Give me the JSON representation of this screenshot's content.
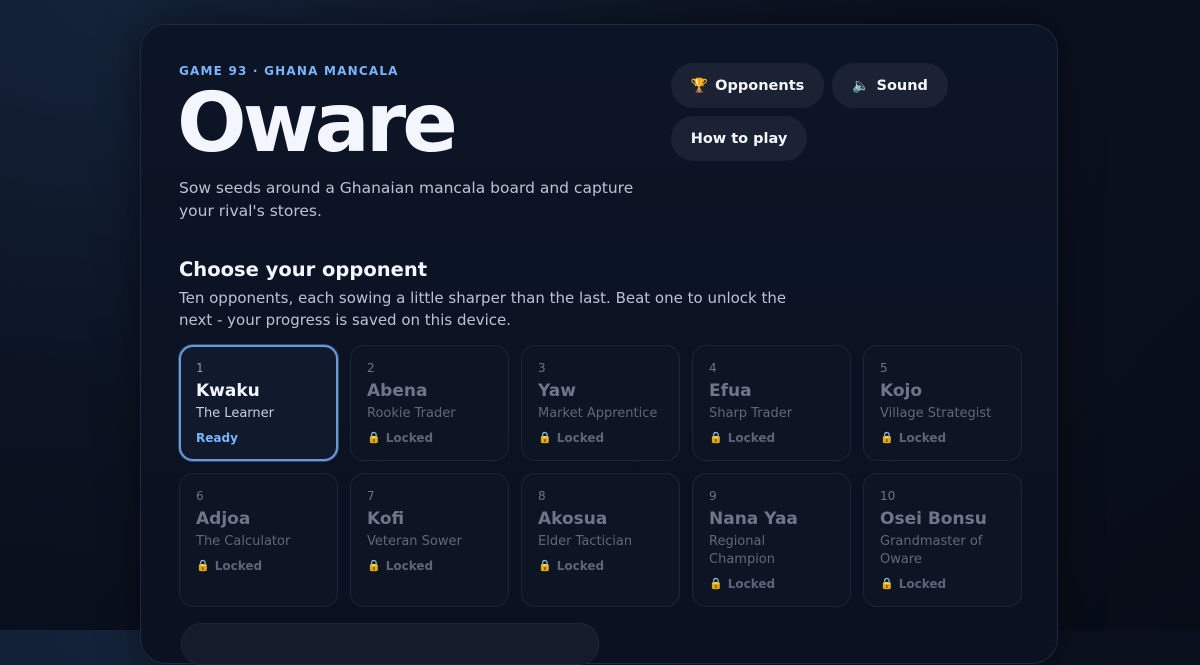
{
  "header": {
    "eyebrow": "GAME 93 · GHANA MANCALA",
    "title": "Oware",
    "subtitle": "Sow seeds around a Ghanaian mancala board and capture your rival's stores."
  },
  "buttons": {
    "opponents": {
      "icon": "🏆",
      "icon_name": "trophy-icon",
      "label": "Opponents"
    },
    "sound": {
      "icon": "🔈",
      "icon_name": "speaker-icon",
      "label": "Sound"
    },
    "howto": {
      "label": "How to play"
    }
  },
  "section": {
    "title": "Choose your opponent",
    "description": "Ten opponents, each sowing a little sharper than the last. Beat one to unlock the next - your progress is saved on this device."
  },
  "opponents": [
    {
      "num": "1",
      "name": "Kwaku",
      "rank": "The Learner",
      "status": "Ready",
      "locked": false
    },
    {
      "num": "2",
      "name": "Abena",
      "rank": "Rookie Trader",
      "status": "Locked",
      "locked": true
    },
    {
      "num": "3",
      "name": "Yaw",
      "rank": "Market Apprentice",
      "status": "Locked",
      "locked": true
    },
    {
      "num": "4",
      "name": "Efua",
      "rank": "Sharp Trader",
      "status": "Locked",
      "locked": true
    },
    {
      "num": "5",
      "name": "Kojo",
      "rank": "Village Strategist",
      "status": "Locked",
      "locked": true
    },
    {
      "num": "6",
      "name": "Adjoa",
      "rank": "The Calculator",
      "status": "Locked",
      "locked": true
    },
    {
      "num": "7",
      "name": "Kofi",
      "rank": "Veteran Sower",
      "status": "Locked",
      "locked": true
    },
    {
      "num": "8",
      "name": "Akosua",
      "rank": "Elder Tactician",
      "status": "Locked",
      "locked": true
    },
    {
      "num": "9",
      "name": "Nana Yaa",
      "rank": "Regional Champion",
      "status": "Locked",
      "locked": true
    },
    {
      "num": "10",
      "name": "Osei Bonsu",
      "rank": "Grandmaster of Oware",
      "status": "Locked",
      "locked": true
    }
  ],
  "icons": {
    "lock": "🔒",
    "lock_name": "lock-icon"
  },
  "colors": {
    "accent": "#79b4ff",
    "lock": "#a98a3a",
    "background": "#0a1120"
  }
}
